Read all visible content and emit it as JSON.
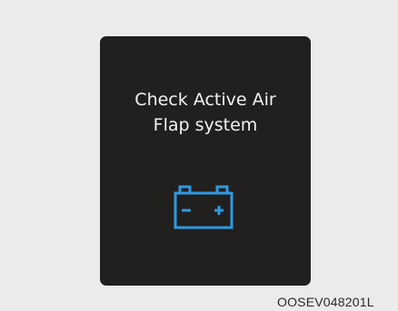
{
  "warning": {
    "line1": "Check Active Air",
    "line2": "Flap system",
    "icon": "battery-icon",
    "icon_color": "#2d9ae0",
    "text_color": "#f2f2f2",
    "panel_color": "#221f1f"
  },
  "figure_code": "OOSEV048201L"
}
